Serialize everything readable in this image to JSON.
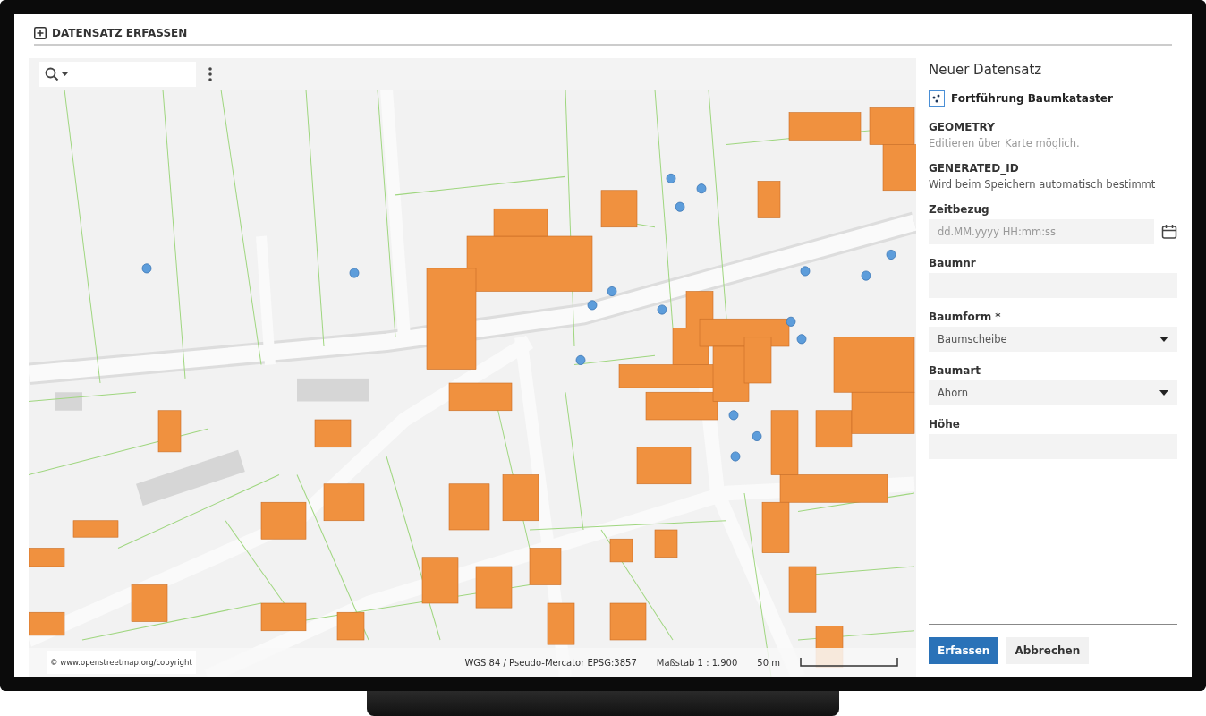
{
  "header": {
    "title": "DATENSATZ ERFASSEN"
  },
  "map": {
    "attribution": "© www.openstreetmap.org/copyright",
    "projection": "WGS 84 / Pseudo-Mercator EPSG:3857",
    "scale": "Maßstab 1 : 1.900",
    "scale_bar": "50 m"
  },
  "panel": {
    "title": "Neuer Datensatz",
    "layer": "Fortführung Baumkataster",
    "fields": [
      {
        "kind": "info",
        "label": "GEOMETRY",
        "text": "Editieren über Karte möglich.",
        "muted": true
      },
      {
        "kind": "info",
        "label": "GENERATED_ID",
        "text": "Wird beim Speichern automatisch bestimmt",
        "muted": false
      },
      {
        "kind": "datetime",
        "label": "Zeitbezug",
        "placeholder": "dd.MM.yyyy HH:mm:ss"
      },
      {
        "kind": "text",
        "label": "Baumnr"
      },
      {
        "kind": "select",
        "label": "Baumform *",
        "value": "Baumscheibe"
      },
      {
        "kind": "select",
        "label": "Baumart",
        "value": "Ahorn"
      },
      {
        "kind": "text",
        "label": "Höhe"
      }
    ],
    "buttons": [
      {
        "label": "Erfassen",
        "primary": true
      },
      {
        "label": "Abbrechen",
        "primary": false
      }
    ]
  }
}
